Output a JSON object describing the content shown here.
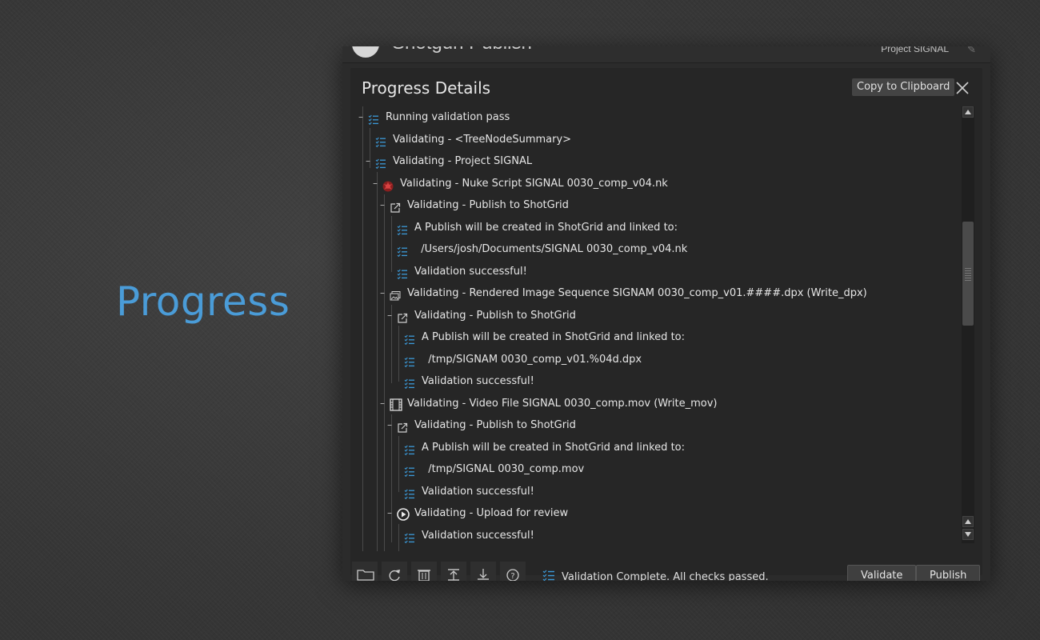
{
  "slide": {
    "title": "Progress"
  },
  "window": {
    "app_title": "Shotgun Publish",
    "project": "Project SIGNAL"
  },
  "panel": {
    "title": "Progress Details",
    "copy_label": "Copy to Clipboard"
  },
  "tree": [
    {
      "level": 0,
      "icon": "checklist-icon",
      "expander": true,
      "text": "Running validation pass"
    },
    {
      "level": 1,
      "icon": "checklist-icon",
      "expander": false,
      "text": "Validating - <TreeNodeSummary>"
    },
    {
      "level": 1,
      "icon": "checklist-icon",
      "expander": true,
      "text": "Validating - Project SIGNAL"
    },
    {
      "level": 2,
      "icon": "nuke-icon",
      "expander": true,
      "text": "Validating - Nuke Script SIGNAL 0030_comp_v04.nk"
    },
    {
      "level": 3,
      "icon": "publish-icon",
      "expander": true,
      "text": "Validating - Publish to ShotGrid"
    },
    {
      "level": 4,
      "icon": "checklist-icon",
      "expander": false,
      "text": "A Publish will be created in ShotGrid and linked to:"
    },
    {
      "level": 4,
      "icon": "checklist-icon",
      "expander": false,
      "text": "  /Users/josh/Documents/SIGNAL 0030_comp_v04.nk"
    },
    {
      "level": 4,
      "icon": "checklist-icon",
      "expander": false,
      "text": "Validation successful!"
    },
    {
      "level": 3,
      "icon": "image-sequence-icon",
      "expander": true,
      "text": "Validating - Rendered Image Sequence SIGNAM 0030_comp_v01.####.dpx (Write_dpx)"
    },
    {
      "level": 4,
      "icon": "publish-icon",
      "expander": true,
      "text": "Validating - Publish to ShotGrid"
    },
    {
      "level": 5,
      "icon": "checklist-icon",
      "expander": false,
      "text": "A Publish will be created in ShotGrid and linked to:"
    },
    {
      "level": 5,
      "icon": "checklist-icon",
      "expander": false,
      "text": "  /tmp/SIGNAM 0030_comp_v01.%04d.dpx"
    },
    {
      "level": 5,
      "icon": "checklist-icon",
      "expander": false,
      "text": "Validation successful!"
    },
    {
      "level": 3,
      "icon": "film-icon",
      "expander": true,
      "text": "Validating - Video File SIGNAL 0030_comp.mov (Write_mov)"
    },
    {
      "level": 4,
      "icon": "publish-icon",
      "expander": true,
      "text": "Validating - Publish to ShotGrid"
    },
    {
      "level": 5,
      "icon": "checklist-icon",
      "expander": false,
      "text": "A Publish will be created in ShotGrid and linked to:"
    },
    {
      "level": 5,
      "icon": "checklist-icon",
      "expander": false,
      "text": "  /tmp/SIGNAL 0030_comp.mov"
    },
    {
      "level": 5,
      "icon": "checklist-icon",
      "expander": false,
      "text": "Validation successful!"
    },
    {
      "level": 4,
      "icon": "play-icon",
      "expander": true,
      "text": "Validating - Upload for review"
    },
    {
      "level": 5,
      "icon": "checklist-icon",
      "expander": false,
      "text": "Validation successful!"
    }
  ],
  "footer": {
    "tools": [
      "folder-icon",
      "refresh-icon",
      "trash-icon",
      "collapse-all-icon",
      "expand-all-icon",
      "help-icon"
    ],
    "status": "Validation Complete. All checks passed.",
    "validate_label": "Validate",
    "publish_label": "Publish"
  },
  "colors": {
    "accent": "#4a9cd8",
    "checklist": "#3b9ad9",
    "background": "#3a3a3a",
    "panel": "#262626"
  }
}
